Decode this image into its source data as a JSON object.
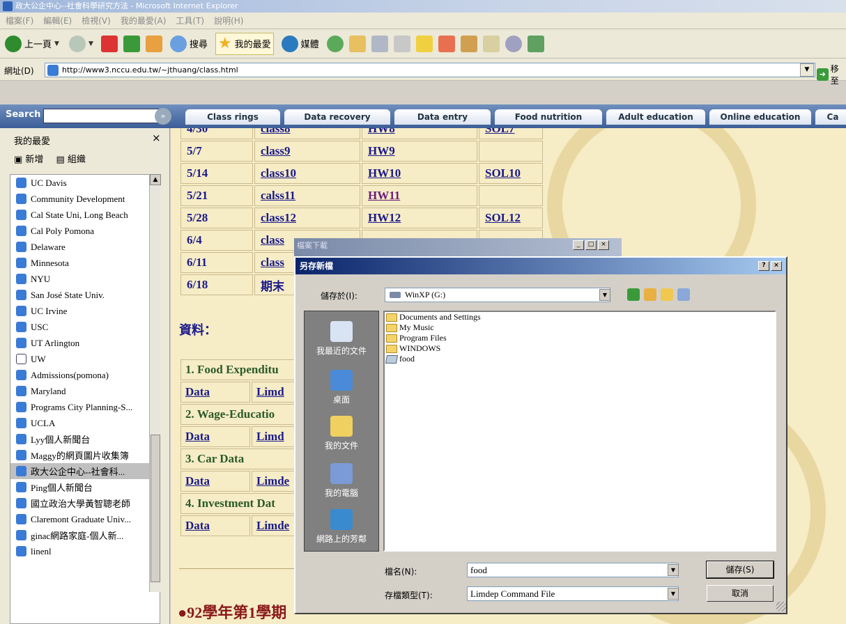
{
  "window": {
    "title": "政大公企中心--社會科學研究方法 - Microsoft Internet Explorer"
  },
  "menu": [
    "檔案(F)",
    "編輯(E)",
    "檢視(V)",
    "我的最愛(A)",
    "工具(T)",
    "說明(H)"
  ],
  "toolbar": {
    "back": "上一頁",
    "search": "搜尋",
    "favorites": "我的最愛",
    "media": "媒體"
  },
  "address": {
    "label": "網址(D)",
    "url": "http://www3.nccu.edu.tw/~jthuang/class.html",
    "go": "移至"
  },
  "searchbar": {
    "label": "Search",
    "tabs": [
      "Class rings",
      "Data recovery",
      "Data entry",
      "Food nutrition",
      "Adult education",
      "Online education",
      "Ca"
    ]
  },
  "sidebar": {
    "title": "我的最愛",
    "close": "×",
    "add": "新增",
    "organize": "組織",
    "items": [
      "UC Davis",
      "Community Development",
      "Cal State Uni, Long Beach",
      "Cal Poly Pomona",
      "Delaware",
      "Minnesota",
      "NYU",
      "San José State Univ.",
      "UC Irvine",
      "USC",
      "UT Arlington",
      "UW",
      "Admissions(pomona)",
      "Maryland",
      "Programs City Planning-S...",
      "UCLA",
      "Lyy個人新聞台",
      "Maggy的網頁圖片收集簿",
      "政大公企中心--社會科...",
      "Ping個人新聞台",
      "國立政治大學黃智聰老師",
      "Claremont Graduate Univ...",
      "ginac網路家庭-個人新...",
      "linenl"
    ]
  },
  "schedule": [
    {
      "date": "4/30",
      "cls": "class8",
      "hw": "HW8",
      "sol": "SOL7"
    },
    {
      "date": "5/7",
      "cls": "class9",
      "hw": "HW9",
      "sol": ""
    },
    {
      "date": "5/14",
      "cls": "class10",
      "hw": "HW10",
      "sol": "SOL10"
    },
    {
      "date": "5/21",
      "cls": "calss11",
      "hw": "HW11",
      "sol": ""
    },
    {
      "date": "5/28",
      "cls": "class12",
      "hw": "HW12",
      "sol": "SOL12"
    },
    {
      "date": "6/4",
      "cls": "class",
      "hw": "",
      "sol": ""
    },
    {
      "date": "6/11",
      "cls": "class",
      "hw": "",
      "sol": ""
    },
    {
      "date": "6/18",
      "cls": "期末",
      "hw": "",
      "sol": ""
    }
  ],
  "data_heading": "資料：",
  "datasets": [
    {
      "title": "1. Food Expenditu",
      "data": "Data",
      "limdep": "Limd"
    },
    {
      "title": "2. Wage-Educatio",
      "data": "Data",
      "limdep": "Limd"
    },
    {
      "title": "3. Car Data",
      "data": "Data",
      "limdep": "Limde"
    },
    {
      "title": "4. Investment Dat",
      "data": "Data",
      "limdep": "Limde"
    }
  ],
  "semester": "●92學年第1學期",
  "download_window": {
    "title": "檔案下載"
  },
  "dialog": {
    "title": "另存新檔",
    "save_in_label": "儲存於(I):",
    "save_in_value": "WinXP (G:)",
    "places": [
      "我最近的文件",
      "桌面",
      "我的文件",
      "我的電腦",
      "網路上的芳鄰"
    ],
    "files": [
      {
        "name": "Documents and Settings",
        "type": "folder"
      },
      {
        "name": "My Music",
        "type": "folder"
      },
      {
        "name": "Program Files",
        "type": "folder"
      },
      {
        "name": "WINDOWS",
        "type": "folder"
      },
      {
        "name": "food",
        "type": "file"
      }
    ],
    "filename_label": "檔名(N):",
    "filename_value": "food",
    "filetype_label": "存檔類型(T):",
    "filetype_value": "Limdep Command File",
    "save_button": "儲存(S)",
    "cancel_button": "取消",
    "help": "?",
    "close": "×"
  }
}
